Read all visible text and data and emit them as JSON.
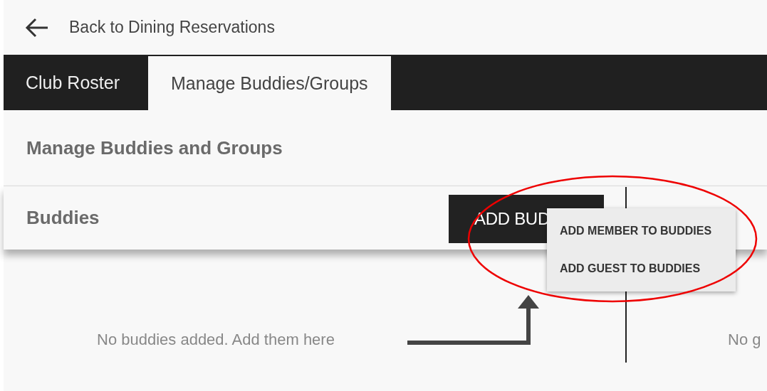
{
  "back_link": "Back to Dining Reservations",
  "tabs": [
    {
      "label": "Club Roster",
      "selected": false
    },
    {
      "label": "Manage Buddies/Groups",
      "selected": true
    }
  ],
  "page_title": "Manage Buddies and Groups",
  "section": {
    "title": "Buddies",
    "button_label": "ADD BUD",
    "menu": {
      "items": [
        "ADD MEMBER TO BUDDIES",
        "ADD GUEST TO BUDDIES"
      ]
    }
  },
  "empty_states": [
    "No buddies added. Add them here",
    "No g"
  ]
}
